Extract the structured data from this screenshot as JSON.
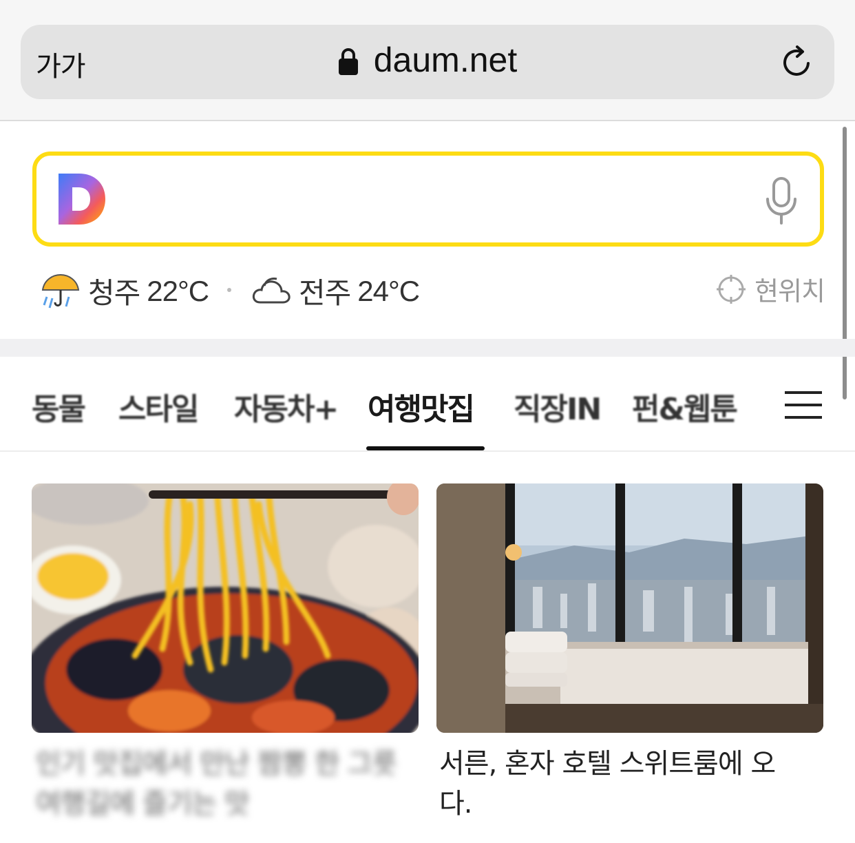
{
  "browser": {
    "text_size_label": "가가",
    "url": "daum.net"
  },
  "search": {
    "logo": "D",
    "placeholder": ""
  },
  "weather": {
    "items": [
      {
        "city": "청주",
        "temp": "22°C",
        "icon": "rain-umbrella-icon"
      },
      {
        "city": "전주",
        "temp": "24°C",
        "icon": "cloud-icon"
      }
    ],
    "location_label": "현위치"
  },
  "tabs": [
    {
      "label": "동물"
    },
    {
      "label": "스타일"
    },
    {
      "label": "자동차+"
    },
    {
      "label": "여행맛집",
      "active": true
    },
    {
      "label": "직장IN"
    },
    {
      "label": "펀&웹툰"
    }
  ],
  "cards": [
    {
      "title": "인기 맛집에서 만난 짬뽕 한 그릇 여행길에 즐기는 맛"
    },
    {
      "title": "서른, 혼자 호텔 스위트룸에 오다."
    }
  ],
  "colors": {
    "search_border": "#fddc14",
    "tab_underline": "#111111"
  }
}
